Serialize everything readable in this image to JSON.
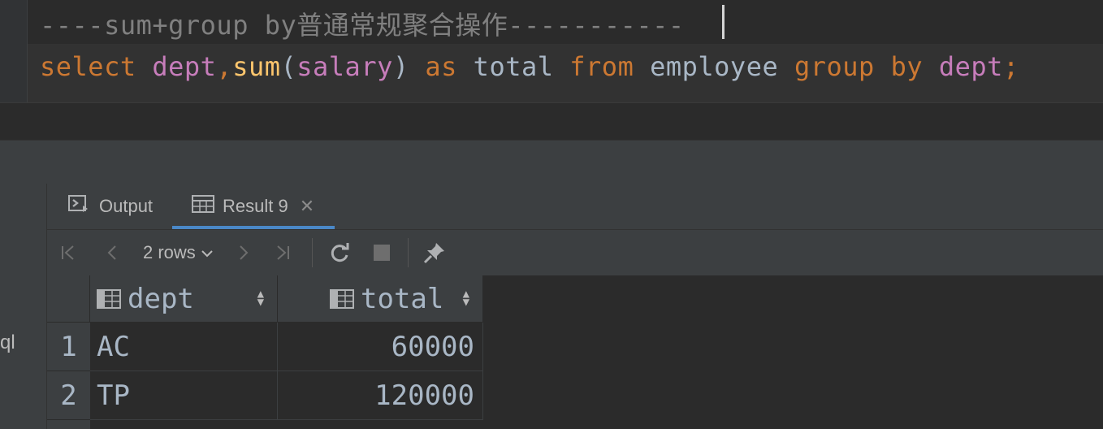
{
  "editor": {
    "comment_line": "----sum+group by普通常规聚合操作-----------",
    "sql": {
      "select": "select",
      "dept": "dept",
      "comma": ",",
      "sum": "sum",
      "open": "(",
      "salary": "salary",
      "close": ")",
      "as": "as",
      "total": "total",
      "from": "from",
      "employee": "employee",
      "group": "group",
      "by": "by",
      "dept2": "dept",
      "semi": ";"
    }
  },
  "tabs": {
    "output_label": "Output",
    "result_label": "Result 9"
  },
  "toolbar": {
    "rows_label": "2 rows"
  },
  "left_strip": {
    "partial_text": "ql"
  },
  "grid": {
    "columns": [
      "dept",
      "total"
    ],
    "rows": [
      {
        "num": "1",
        "dept": "AC",
        "total": "60000"
      },
      {
        "num": "2",
        "dept": "TP",
        "total": "120000"
      }
    ]
  },
  "colors": {
    "keyword": "#cc7832",
    "identifier": "#c77dbb",
    "function": "#ffc66d",
    "plain": "#a9b7c6",
    "comment": "#808080",
    "tab_underline": "#4a88c7"
  },
  "icons": [
    "output-console-icon",
    "table-icon",
    "close-icon",
    "first-page-icon",
    "prev-page-icon",
    "chevron-down-icon",
    "next-page-icon",
    "last-page-icon",
    "refresh-icon",
    "stop-icon",
    "pin-icon",
    "column-icon",
    "sort-icon"
  ]
}
